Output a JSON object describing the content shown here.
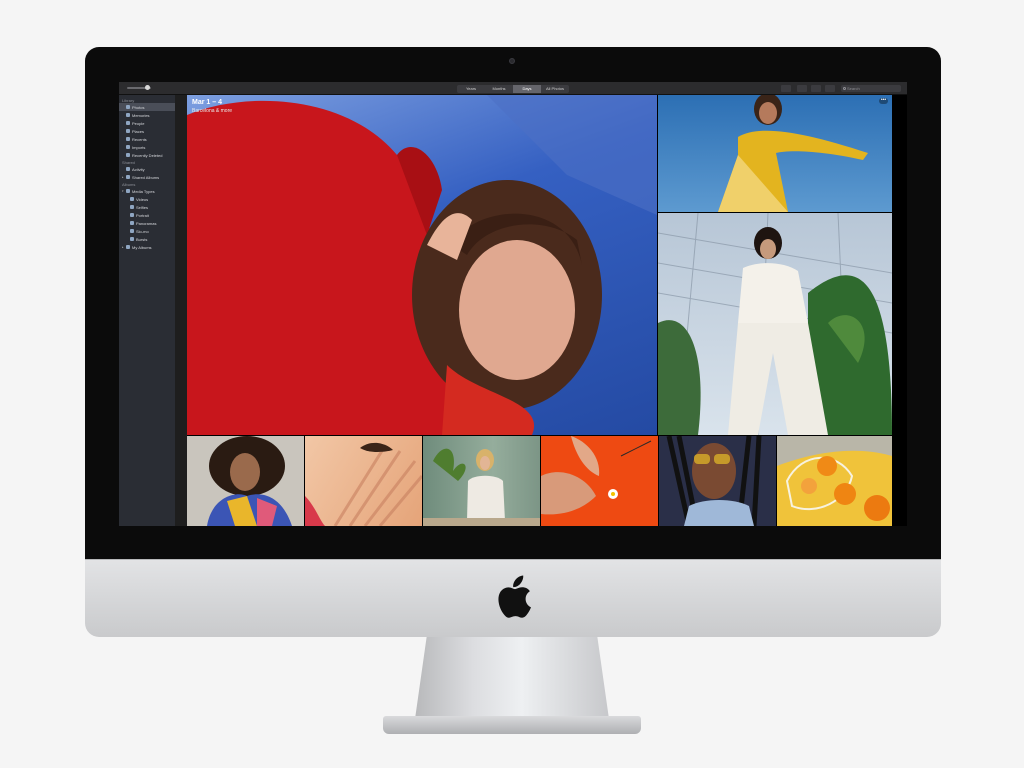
{
  "toolbar": {
    "segments": [
      "Years",
      "Months",
      "Days",
      "All Photos"
    ],
    "active_segment": "Days",
    "search_placeholder": "Search"
  },
  "sidebar": {
    "sections": [
      {
        "header": "Library",
        "items": [
          {
            "label": "Photos",
            "icon": "photos-icon",
            "selected": true
          },
          {
            "label": "Memories",
            "icon": "memories-icon"
          },
          {
            "label": "People",
            "icon": "people-icon"
          },
          {
            "label": "Places",
            "icon": "places-icon"
          },
          {
            "label": "Recents",
            "icon": "recents-icon"
          },
          {
            "label": "Imports",
            "icon": "imports-icon"
          },
          {
            "label": "Recently Deleted",
            "icon": "trash-icon"
          }
        ]
      },
      {
        "header": "Shared",
        "items": [
          {
            "label": "Activity",
            "icon": "activity-icon"
          },
          {
            "label": "Shared Albums",
            "icon": "shared-albums-icon",
            "disclosure": true
          }
        ]
      },
      {
        "header": "Albums",
        "items": [
          {
            "label": "Media Types",
            "icon": "media-types-icon",
            "disclosure": true,
            "open": true
          },
          {
            "label": "Videos",
            "icon": "videos-icon",
            "sub": true
          },
          {
            "label": "Selfies",
            "icon": "selfies-icon",
            "sub": true
          },
          {
            "label": "Portrait",
            "icon": "portrait-icon",
            "sub": true
          },
          {
            "label": "Panoramas",
            "icon": "panoramas-icon",
            "sub": true
          },
          {
            "label": "Slo-mo",
            "icon": "slomo-icon",
            "sub": true
          },
          {
            "label": "Bursts",
            "icon": "bursts-icon",
            "sub": true
          },
          {
            "label": "My Albums",
            "icon": "my-albums-icon",
            "disclosure": true
          }
        ]
      }
    ]
  },
  "content": {
    "day_title": "Mar 1 – 4",
    "day_subtitle": "Barcelona & more",
    "more_label": "•••"
  },
  "colors": {
    "sidebar_bg": "#2a2d34",
    "toolbar_bg": "#2c2c2e",
    "sky_blue": "#2f58b6",
    "sweater_red": "#c8161c"
  }
}
